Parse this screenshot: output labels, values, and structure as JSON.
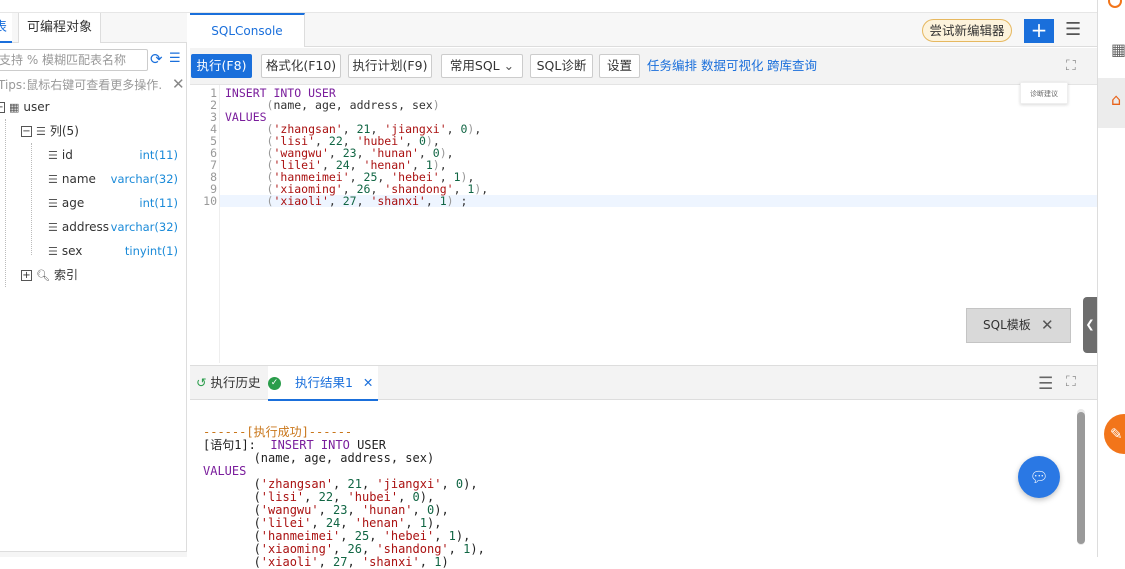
{
  "left_panel": {
    "tab_partial": "表",
    "tab_programmable": "可编程对象",
    "search_placeholder": "支持 % 模糊匹配表名称",
    "tips": "Tips:鼠标右键可查看更多操作…",
    "tree": {
      "table": "user",
      "columns_label": "列(5)",
      "columns": [
        {
          "name": "id",
          "type": "int(11)"
        },
        {
          "name": "name",
          "type": "varchar(32)"
        },
        {
          "name": "age",
          "type": "int(11)"
        },
        {
          "name": "address",
          "type": "varchar(32)"
        },
        {
          "name": "sex",
          "type": "tinyint(1)"
        }
      ],
      "index_label": "索引"
    }
  },
  "main": {
    "tab": "SQLConsole",
    "try_new_editor": "尝试新编辑器",
    "plus": "+",
    "toolbar": {
      "execute": "执行(F8)",
      "format": "格式化(F10)",
      "plan": "执行计划(F9)",
      "common_sql": "常用SQL",
      "diagnose": "SQL诊断",
      "settings": "设置",
      "links": [
        "任务编排",
        "数据可视化",
        "跨库查询"
      ]
    },
    "tooltip": "诊断建议",
    "sql_template": "SQL模板"
  },
  "results": {
    "history_tab": "执行历史",
    "result_tab": "执行结果1",
    "success_line": "------[执行成功]------",
    "stmt_label": "[语句1]:"
  },
  "colors": {
    "accent": "#1a6fdb",
    "keyword": "#7a1d9c",
    "string": "#aa1111",
    "number": "#116644",
    "orange": "#f2751a"
  }
}
